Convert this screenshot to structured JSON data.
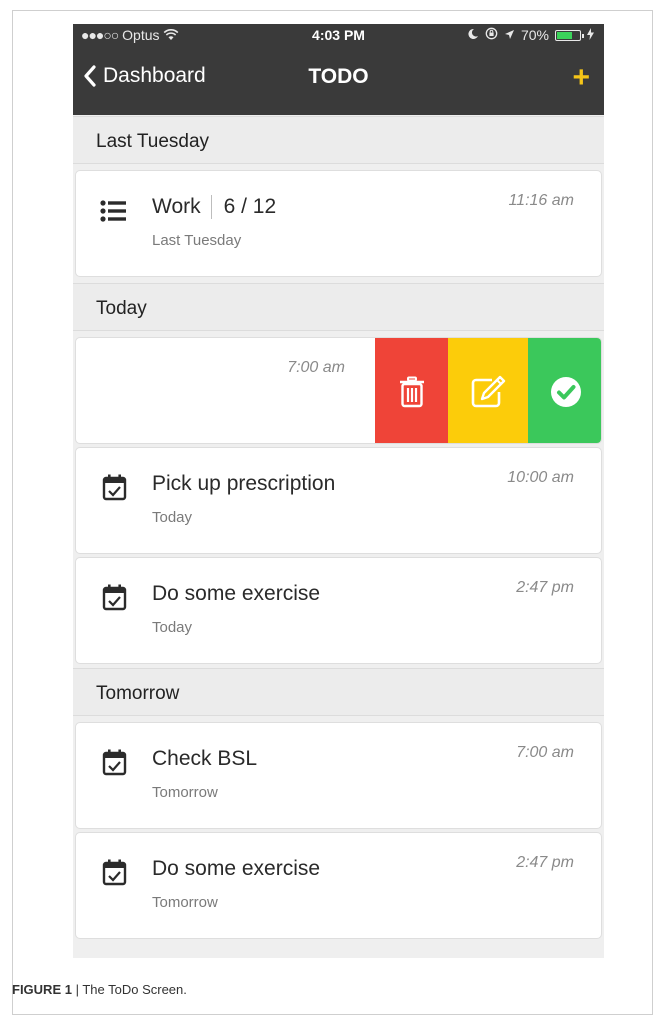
{
  "status_bar": {
    "carrier": "Optus",
    "signal_dots": "●●●○○",
    "time": "4:03 PM",
    "battery_percent": "70%",
    "battery_level": 0.7,
    "battery_color": "#3bd35a"
  },
  "nav": {
    "back_label": "Dashboard",
    "title": "TODO",
    "add_label": "+",
    "accent_color": "#f5c518"
  },
  "sections": {
    "last_tuesday": "Last Tuesday",
    "today": "Today",
    "tomorrow": "Tomorrow"
  },
  "items": {
    "work": {
      "name": "Work",
      "count": "6 / 12",
      "sub": "Last Tuesday",
      "time": "11:16 am",
      "icon": "list-icon"
    },
    "swiped": {
      "time": "7:00 am",
      "actions": [
        {
          "name": "delete",
          "icon": "trash-icon",
          "color": "#ef4438"
        },
        {
          "name": "edit",
          "icon": "edit-icon",
          "color": "#fccc0a"
        },
        {
          "name": "complete",
          "icon": "check-circle-icon",
          "color": "#3bc85b"
        }
      ]
    },
    "prescription": {
      "name": "Pick up prescription",
      "sub": "Today",
      "time": "10:00 am",
      "icon": "calendar-check-icon"
    },
    "exercise_today": {
      "name": "Do some exercise",
      "sub": "Today",
      "time": "2:47 pm",
      "icon": "calendar-check-icon"
    },
    "bsl": {
      "name": "Check BSL",
      "sub": "Tomorrow",
      "time": "7:00 am",
      "icon": "calendar-check-icon"
    },
    "exercise_tomorrow": {
      "name": "Do some exercise",
      "sub": "Tomorrow",
      "time": "2:47 pm",
      "icon": "calendar-check-icon"
    }
  },
  "caption": {
    "label": "FIGURE 1",
    "text": " | The ToDo Screen."
  }
}
